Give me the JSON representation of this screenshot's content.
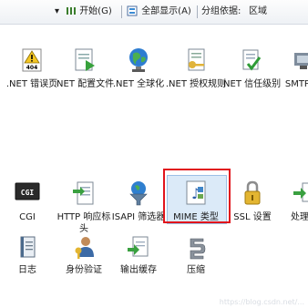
{
  "toolbar": {
    "start_label": "开始(G)",
    "show_all_label": "全部显示(A)",
    "group_by_label": "分组依据:",
    "group_by_value": "区域"
  },
  "features_row1": [
    {
      "label": ".NET 错误页",
      "icon": "error-page-404-icon"
    },
    {
      "label": ".NET 配置文件",
      "icon": "config-file-icon"
    },
    {
      "label": ".NET 全球化",
      "icon": "globe-icon"
    },
    {
      "label": ".NET 授权规则",
      "icon": "authorization-rules-icon"
    },
    {
      "label": ".NET 信任级别",
      "icon": "trust-level-icon"
    },
    {
      "label": "SMTP 电",
      "icon": "smtp-email-icon"
    }
  ],
  "features_row2": [
    {
      "label": "CGI",
      "icon": "cgi-icon"
    },
    {
      "label": "HTTP 响应标头",
      "icon": "http-response-headers-icon"
    },
    {
      "label": "ISAPI 筛选器",
      "icon": "isapi-filters-icon"
    },
    {
      "label": "MIME 类型",
      "icon": "mime-types-icon"
    },
    {
      "label": "SSL 设置",
      "icon": "ssl-lock-icon"
    },
    {
      "label": "处理程",
      "icon": "handler-mappings-icon"
    }
  ],
  "features_row3": [
    {
      "label": "日志",
      "icon": "logging-icon"
    },
    {
      "label": "身份验证",
      "icon": "authentication-icon"
    },
    {
      "label": "输出缓存",
      "icon": "output-caching-icon"
    },
    {
      "label": "压缩",
      "icon": "compression-icon"
    }
  ],
  "watermark": "https://blog.csdn.net/..."
}
